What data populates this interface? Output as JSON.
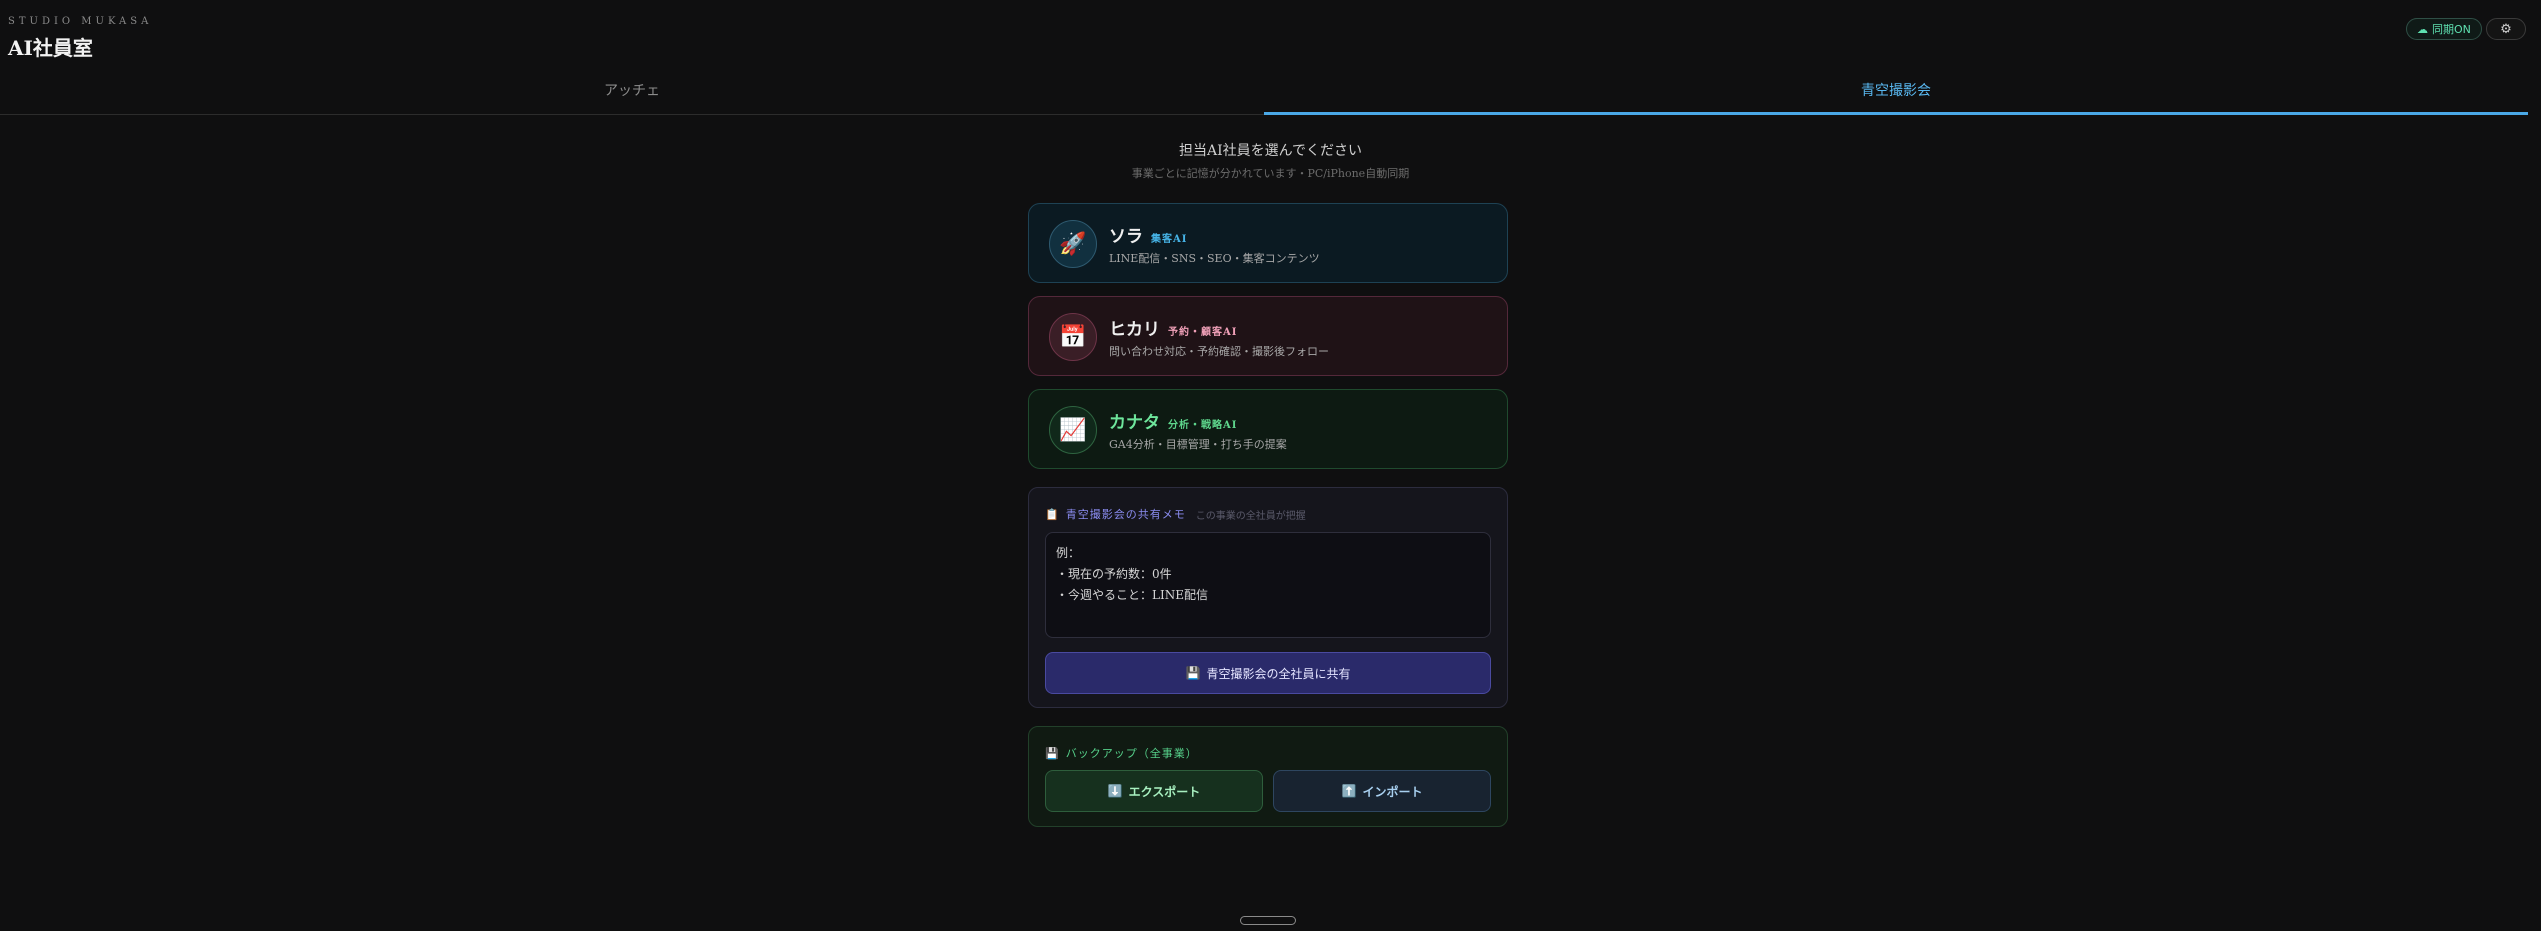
{
  "brand": {
    "sub": "STUDIO MUKASA",
    "title": "AI社員室"
  },
  "header": {
    "sync_icon": "cloud-icon",
    "sync_label": "同期ON",
    "settings_icon": "gear-icon"
  },
  "tabs": [
    {
      "label": "アッチェ",
      "active": false
    },
    {
      "label": "青空撮影会",
      "active": true
    }
  ],
  "intro": {
    "heading": "担当AI社員を選んでください",
    "sub": "事業ごとに記憶が分かれています・PC/iPhone自動同期"
  },
  "employees": [
    {
      "icon": "🚀",
      "name": "ソラ",
      "role": "集客AI",
      "desc": "LINE配信・SNS・SEO・集客コンテンツ",
      "accent": "#46b3e6"
    },
    {
      "icon": "📅",
      "name": "ヒカリ",
      "role": "予約・顧客AI",
      "desc": "問い合わせ対応・予約確認・撮影後フォロー",
      "accent": "#f0a0b8"
    },
    {
      "icon": "📈",
      "name": "カナタ",
      "role": "分析・戦略AI",
      "desc": "GA4分析・目標管理・打ち手の提案",
      "accent": "#5ed68c"
    }
  ],
  "memo": {
    "icon": "📋",
    "title": "青空撮影会の共有メモ",
    "note": "この事業の全社員が把握",
    "placeholder": "例：\n・現在の予約数：0件\n・今週やること：LINE配信",
    "share_icon": "💾",
    "share_label": "青空撮影会の全社員に共有"
  },
  "backup": {
    "icon": "💾",
    "title": "バックアップ（全事業）",
    "export_icon": "⬇️",
    "export_label": "エクスポート",
    "import_icon": "⬆️",
    "import_label": "インポート"
  }
}
